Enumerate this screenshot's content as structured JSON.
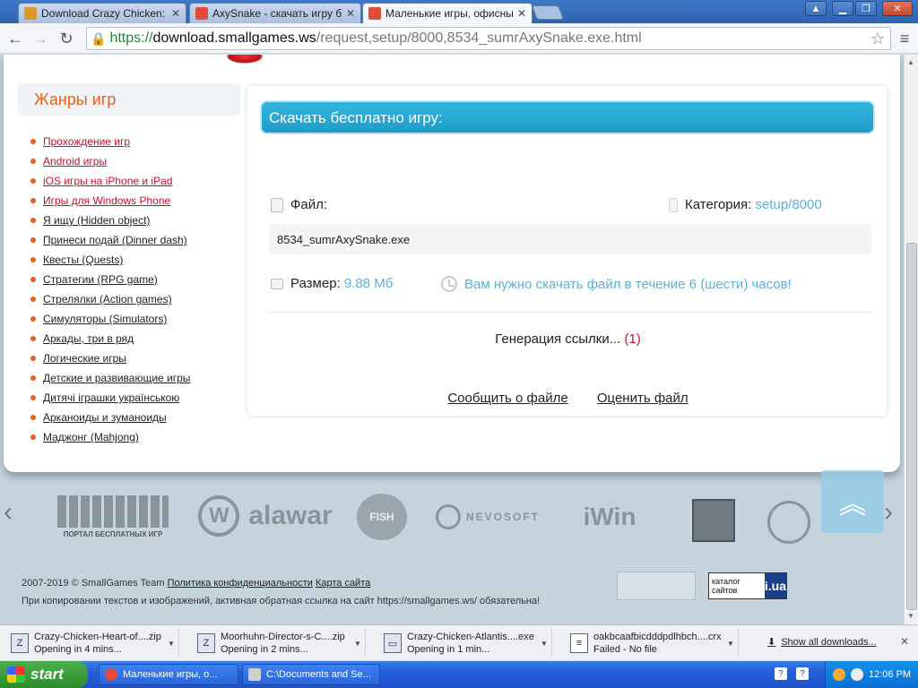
{
  "browser": {
    "tabs": [
      {
        "title": "Download Crazy Chicken: He",
        "favicon_color": "#d99a2b"
      },
      {
        "title": "AxySnake - скачать игру б",
        "favicon_color": "#e14b3b"
      },
      {
        "title": "Маленькие игры, офисные",
        "favicon_color": "#e14b3b"
      }
    ],
    "url": {
      "scheme": "https://",
      "host": "download.smallgames.ws",
      "path": "/request,setup/8000,8534_sumrAxySnake.exe.html"
    }
  },
  "sidebar": {
    "title": "Жанры игр",
    "genres": [
      {
        "label": "Прохождение игр",
        "hot": true
      },
      {
        "label": "Android игры",
        "hot": true
      },
      {
        "label": "iOS игры на iPhone и iPad",
        "hot": true
      },
      {
        "label": "Игры для Windows Phone",
        "hot": true
      },
      {
        "label": "Я ищу (Hidden object)",
        "hot": false
      },
      {
        "label": "Принеси подай (Dinner dash)",
        "hot": false
      },
      {
        "label": "Квесты (Quests)",
        "hot": false
      },
      {
        "label": "Стратегии (RPG game)",
        "hot": false
      },
      {
        "label": "Стрелялки (Action games)",
        "hot": false
      },
      {
        "label": "Симуляторы (Simulators)",
        "hot": false
      },
      {
        "label": "Аркады, три в ряд",
        "hot": false
      },
      {
        "label": "Логические игры",
        "hot": false
      },
      {
        "label": "Детские и развивающие игры",
        "hot": false
      },
      {
        "label": "Дитячі іграшки українською",
        "hot": false
      },
      {
        "label": "Арканоиды и зуманоиды",
        "hot": false
      },
      {
        "label": "Маджонг (Mahjong)",
        "hot": false
      }
    ]
  },
  "download": {
    "heading": "Скачать бесплатно игру:",
    "file_label": "Файл:",
    "category_label": "Категория:",
    "category_value": "setup/8000",
    "filename": "8534_sumrAxySnake.exe",
    "size_label": "Размер:",
    "size_value": "9.88 Мб",
    "time_notice": "Вам нужно скачать файл в течение 6 (шести) часов!",
    "generating_text": "Генерация ссылки...",
    "generating_count": "(1)",
    "report_link": "Сообщить о файле",
    "rate_link": "Оценить файл"
  },
  "partners": [
    "ПОРТАЛ БЕСПЛАТНЫХ ИГР",
    "alawar",
    "NEVOSOFT",
    "iWin"
  ],
  "footer": {
    "copyright": "2007-2019 © SmallGames Team",
    "privacy_link": "Политика конфиденциальности",
    "sitemap_link": "Карта сайта",
    "notice": "При копировании текстов и изображений, активная обратная ссылка на сайт https://smallgames.ws/ обязательна!",
    "catalog_text": "каталог сайтов",
    "catalog_logo": "i.ua"
  },
  "downloads_shelf": {
    "items": [
      {
        "name": "Crazy-Chicken-Heart-of....zip",
        "status": "Opening in 4 mins..."
      },
      {
        "name": "Moorhuhn-Director-s-C....zip",
        "status": "Opening in 2 mins..."
      },
      {
        "name": "Crazy-Chicken-Atlantis....exe",
        "status": "Opening in 1 min..."
      },
      {
        "name": "oakbcaafbicdddpdlhbch....crx",
        "status": "Failed - No file"
      }
    ],
    "show_all": "Show all downloads..."
  },
  "taskbar": {
    "start": "start",
    "tasks": [
      {
        "label": "Маленькие игры, о...",
        "icon_color": "#e14b3b"
      },
      {
        "label": "C:\\Documents and Se...",
        "icon_color": "#d0d0d0"
      }
    ],
    "clock": "12:06 PM"
  }
}
